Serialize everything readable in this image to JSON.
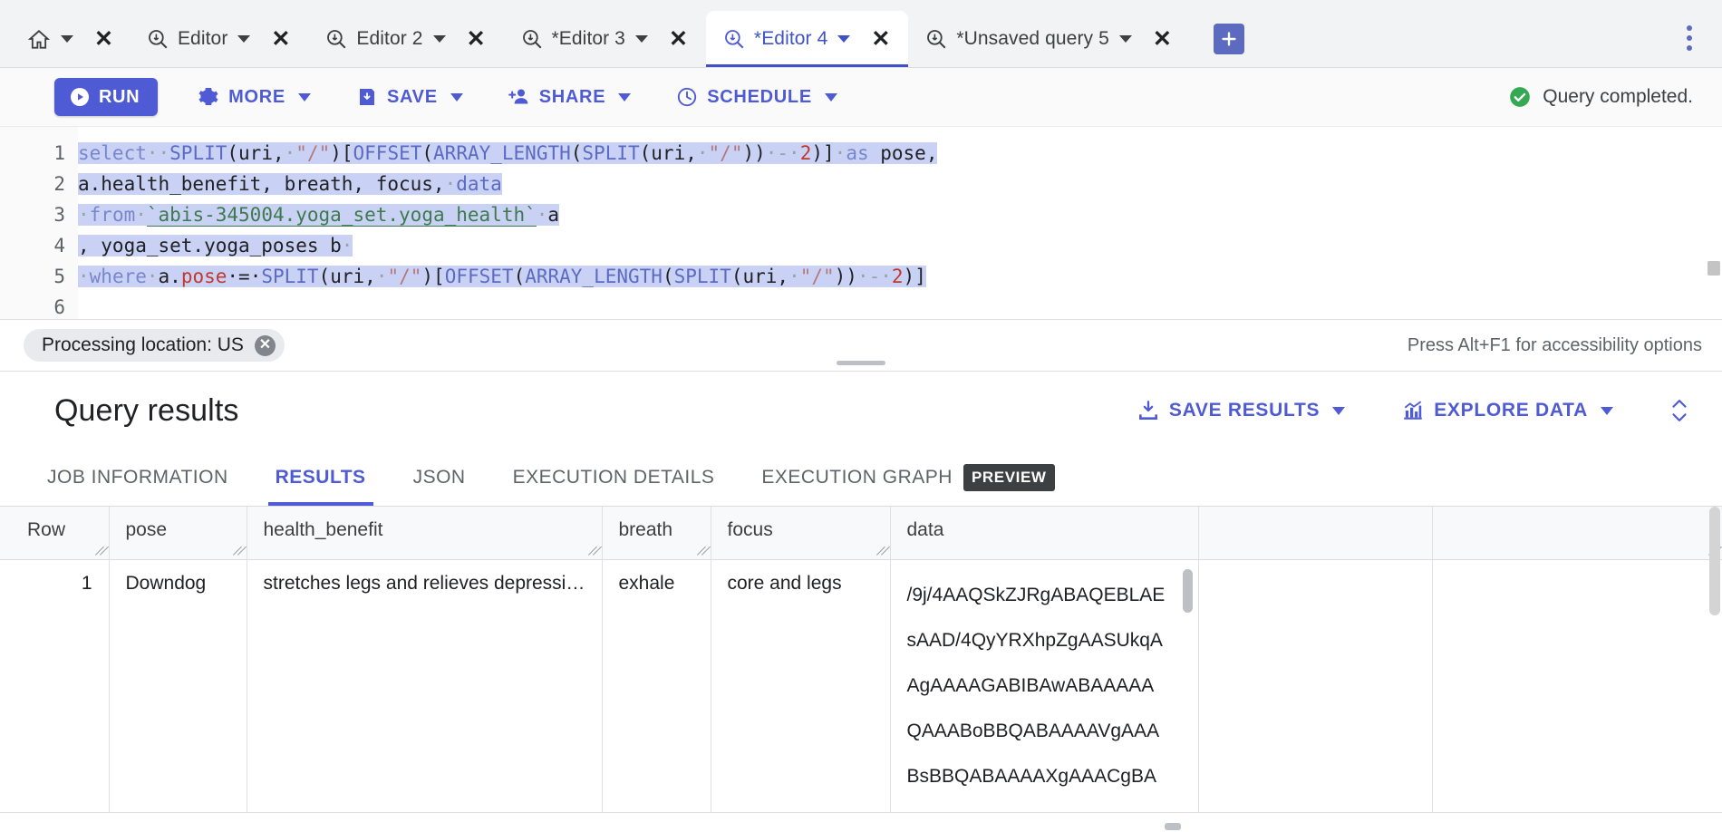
{
  "tabs": [
    {
      "id": "home",
      "label": "",
      "icon": "home-icon",
      "active": false,
      "has_caret": true,
      "has_close": true
    },
    {
      "id": "editor1",
      "label": "Editor",
      "icon": "query-icon",
      "active": false,
      "has_caret": true,
      "has_close": true
    },
    {
      "id": "editor2",
      "label": "Editor 2",
      "icon": "query-icon",
      "active": false,
      "has_caret": true,
      "has_close": true
    },
    {
      "id": "editor3",
      "label": "*Editor 3",
      "icon": "query-icon",
      "active": false,
      "has_caret": true,
      "has_close": true
    },
    {
      "id": "editor4",
      "label": "*Editor 4",
      "icon": "query-icon",
      "active": true,
      "has_caret": true,
      "has_close": true
    },
    {
      "id": "unsaved5",
      "label": "*Unsaved query 5",
      "icon": "query-icon",
      "active": false,
      "has_caret": true,
      "has_close": true
    }
  ],
  "tabbar": {
    "close_glyph": "✕",
    "add_tab_label": "+",
    "overflow_menu_label": "more-options"
  },
  "toolbar": {
    "run_label": "RUN",
    "more_label": "MORE",
    "save_label": "SAVE",
    "share_label": "SHARE",
    "schedule_label": "SCHEDULE",
    "status_text": "Query completed.",
    "status_color": "#34a853",
    "accent_color": "#4f5bd5"
  },
  "editor": {
    "line_numbers": [
      "1",
      "2",
      "3",
      "4",
      "5",
      "6"
    ],
    "query_text": "select  SPLIT(uri, \"/\")[OFFSET(ARRAY_LENGTH(SPLIT(uri, \"/\")) - 2)] as pose,\na.health_benefit, breath, focus, data\n from `abis-345004.yoga_set.yoga_health` a\n, yoga_set.yoga_poses b\n where a.pose = SPLIT(uri, \"/\")[OFFSET(ARRAY_LENGTH(SPLIT(uri, \"/\")) - 2)]\n",
    "lines": [
      {
        "n": "1",
        "segments": [
          {
            "t": "select",
            "c": "kw"
          },
          {
            "t": "··",
            "c": "pl"
          },
          {
            "t": "SPLIT",
            "c": "fn"
          },
          {
            "t": "(",
            "c": ""
          },
          {
            "t": "uri",
            "c": ""
          },
          {
            "t": ",",
            "c": ""
          },
          {
            "t": "·",
            "c": "pl"
          },
          {
            "t": "\"/\"",
            "c": "str"
          },
          {
            "t": ")[",
            "c": ""
          },
          {
            "t": "OFFSET",
            "c": "fn"
          },
          {
            "t": "(",
            "c": ""
          },
          {
            "t": "ARRAY_LENGTH",
            "c": "fn"
          },
          {
            "t": "(",
            "c": ""
          },
          {
            "t": "SPLIT",
            "c": "fn"
          },
          {
            "t": "(",
            "c": ""
          },
          {
            "t": "uri",
            "c": ""
          },
          {
            "t": ",",
            "c": ""
          },
          {
            "t": "·",
            "c": "pl"
          },
          {
            "t": "\"/\"",
            "c": "str"
          },
          {
            "t": "))",
            "c": ""
          },
          {
            "t": "·-·",
            "c": "pl"
          },
          {
            "t": "2",
            "c": "num"
          },
          {
            "t": ")]",
            "c": ""
          },
          {
            "t": "·",
            "c": "pl"
          },
          {
            "t": "as",
            "c": "kw"
          },
          {
            "t": " pose,",
            "c": ""
          }
        ]
      },
      {
        "n": "2",
        "segments": [
          {
            "t": "a.health_benefit, breath, focus,",
            "c": ""
          },
          {
            "t": "·",
            "c": "pl"
          },
          {
            "t": "data",
            "c": "fn"
          }
        ]
      },
      {
        "n": "3",
        "segments": [
          {
            "t": "·",
            "c": "pl"
          },
          {
            "t": "from",
            "c": "kw"
          },
          {
            "t": "·",
            "c": "pl"
          },
          {
            "t": "`abis-345004.yoga_set.yoga_health`",
            "c": "tbl"
          },
          {
            "t": "·",
            "c": "pl"
          },
          {
            "t": "a",
            "c": ""
          }
        ]
      },
      {
        "n": "4",
        "segments": [
          {
            "t": ", yoga_set.yoga_poses b",
            "c": ""
          },
          {
            "t": "·",
            "c": "pl"
          }
        ]
      },
      {
        "n": "5",
        "segments": [
          {
            "t": "·",
            "c": "pl"
          },
          {
            "t": "where",
            "c": "kw"
          },
          {
            "t": "·",
            "c": "pl"
          },
          {
            "t": "a.",
            "c": ""
          },
          {
            "t": "pose",
            "c": "num"
          },
          {
            "t": "·=·",
            "c": ""
          },
          {
            "t": "SPLIT",
            "c": "fn"
          },
          {
            "t": "(",
            "c": ""
          },
          {
            "t": "uri",
            "c": ""
          },
          {
            "t": ",",
            "c": ""
          },
          {
            "t": "·",
            "c": "pl"
          },
          {
            "t": "\"/\"",
            "c": "str"
          },
          {
            "t": ")[",
            "c": ""
          },
          {
            "t": "OFFSET",
            "c": "fn"
          },
          {
            "t": "(",
            "c": ""
          },
          {
            "t": "ARRAY_LENGTH",
            "c": "fn"
          },
          {
            "t": "(",
            "c": ""
          },
          {
            "t": "SPLIT",
            "c": "fn"
          },
          {
            "t": "(",
            "c": ""
          },
          {
            "t": "uri",
            "c": ""
          },
          {
            "t": ",",
            "c": ""
          },
          {
            "t": "·",
            "c": "pl"
          },
          {
            "t": "\"/\"",
            "c": "str"
          },
          {
            "t": "))",
            "c": ""
          },
          {
            "t": "·-·",
            "c": "pl"
          },
          {
            "t": "2",
            "c": "num"
          },
          {
            "t": ")]",
            "c": ""
          }
        ]
      },
      {
        "n": "6",
        "segments": []
      }
    ]
  },
  "processing": {
    "location_label": "Processing location: US",
    "dismiss_label": "✕",
    "accessibility_hint": "Press Alt+F1 for accessibility options"
  },
  "results_header": {
    "title": "Query results",
    "save_results_label": "SAVE RESULTS",
    "explore_data_label": "EXPLORE DATA"
  },
  "result_tabs": [
    {
      "label": "JOB INFORMATION",
      "active": false,
      "badge": ""
    },
    {
      "label": "RESULTS",
      "active": true,
      "badge": ""
    },
    {
      "label": "JSON",
      "active": false,
      "badge": ""
    },
    {
      "label": "EXECUTION DETAILS",
      "active": false,
      "badge": ""
    },
    {
      "label": "EXECUTION GRAPH",
      "active": false,
      "badge": "PREVIEW"
    }
  ],
  "table": {
    "columns": [
      "Row",
      "pose",
      "health_benefit",
      "breath",
      "focus",
      "data"
    ],
    "rows": [
      {
        "row": "1",
        "pose": "Downdog",
        "health_benefit": "stretches legs and relieves depressi…",
        "breath": "exhale",
        "focus": "core and legs",
        "data": [
          "/9j/4AAQSkZJRgABAQEBLAE",
          "sAAD/4QyYRXhpZgAASUkqA",
          "AgAAAAGABIBAwABAAAAA",
          "QAAABoBBQABAAAAVgAAA",
          "BsBBQABAAAAXgAAACgBA"
        ]
      }
    ]
  }
}
